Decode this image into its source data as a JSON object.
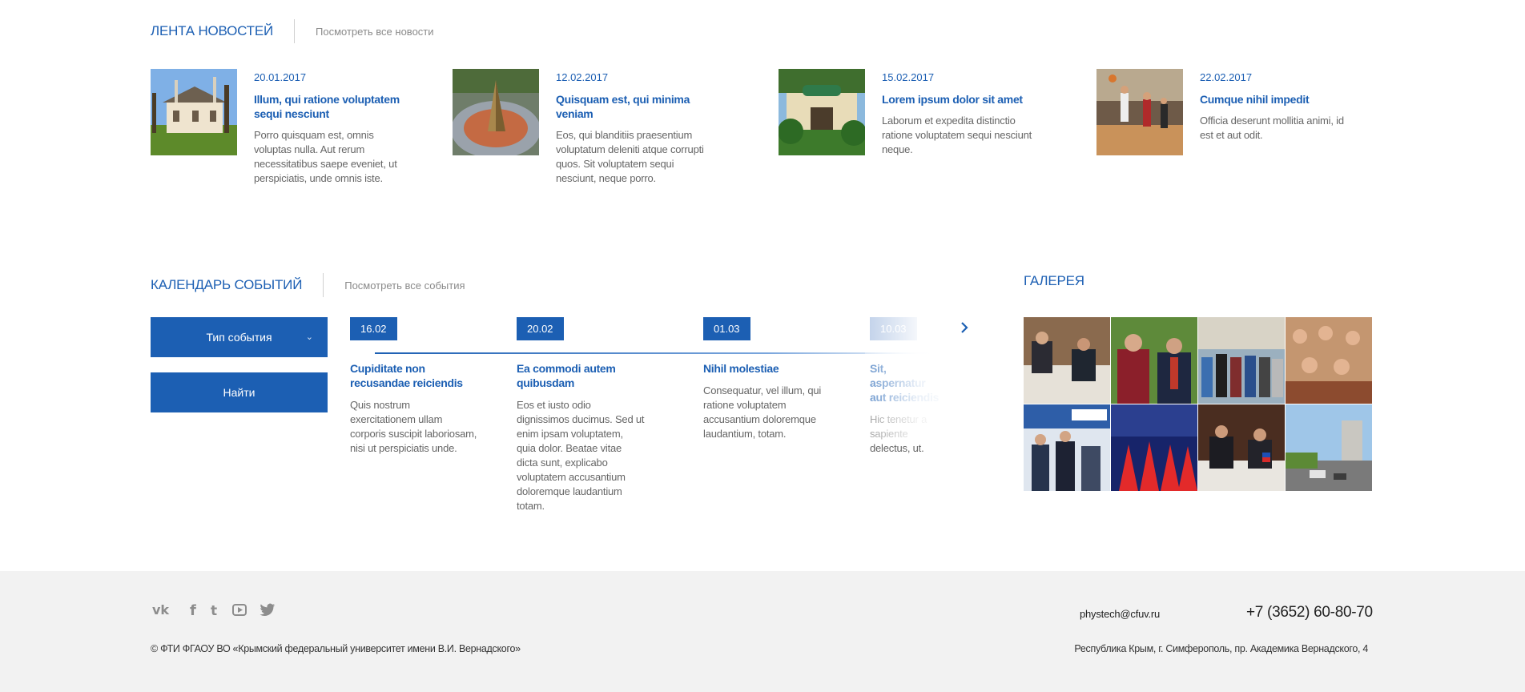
{
  "news": {
    "title": "ЛЕНТА НОВОСТЕЙ",
    "view_all": "Посмотреть все новости",
    "items": [
      {
        "date": "20.01.2017",
        "title": "Illum, qui ratione voluptatem sequi nesciunt",
        "text": "Porro quisquam est, omnis voluptas nulla. Aut rerum necessitatibus saepe eveniet, ut perspiciatis, unde omnis iste."
      },
      {
        "date": "12.02.2017",
        "title": "Quisquam est, qui minima veniam",
        "text": "Eos, qui blanditiis praesentium voluptatum deleniti atque corrupti quos. Sit voluptatem sequi nesciunt, neque porro."
      },
      {
        "date": "15.02.2017",
        "title": "Lorem ipsum dolor sit amet",
        "text": "Laborum et expedita distinctio ratione voluptatem sequi nesciunt neque."
      },
      {
        "date": "22.02.2017",
        "title": "Cumque nihil impedit",
        "text": "Officia deserunt mollitia animi, id est et aut odit."
      }
    ]
  },
  "events": {
    "title": "КАЛЕНДАРЬ СОБЫТИЙ",
    "view_all": "Посмотреть все события",
    "type_select": "Тип события",
    "find_button": "Найти",
    "items": [
      {
        "date": "16.02",
        "title": "Cupiditate non recusandae reiciendis",
        "text": "Quis nostrum exercitationem ullam corporis suscipit laboriosam, nisi ut perspiciatis unde."
      },
      {
        "date": "20.02",
        "title": "Ea commodi autem quibusdam",
        "text": "Eos et iusto odio dignissimos ducimus. Sed ut enim ipsam voluptatem, quia dolor. Beatae vitae dicta sunt, explicabo voluptatem accusantium doloremque laudantium totam."
      },
      {
        "date": "01.03",
        "title": "Nihil molestiae",
        "text": "Consequatur, vel illum, qui ratione voluptatem accusantium doloremque laudantium, totam."
      },
      {
        "date": "10.03",
        "title": "Sit, aspernatur aut reiciendis",
        "text": "Hic tenetur a sapiente delectus, ut."
      }
    ]
  },
  "gallery": {
    "title": "ГАЛЕРЕЯ"
  },
  "footer": {
    "email": "phystech@cfuv.ru",
    "phone": "+7 (3652) 60-80-70",
    "copyright": "© ФТИ ФГАОУ ВО «Крымский федеральный университет имени В.И. Вернадского»",
    "address": "Республика Крым, г. Симферополь, пр. Академика Вернадского, 4",
    "social": [
      "vk-icon",
      "facebook-icon",
      "tumblr-icon",
      "youtube-icon",
      "twitter-icon"
    ]
  },
  "colors": {
    "accent": "#1c5fb3",
    "footer_bg": "#f2f2f2",
    "muted_text": "#8a8a8a"
  }
}
